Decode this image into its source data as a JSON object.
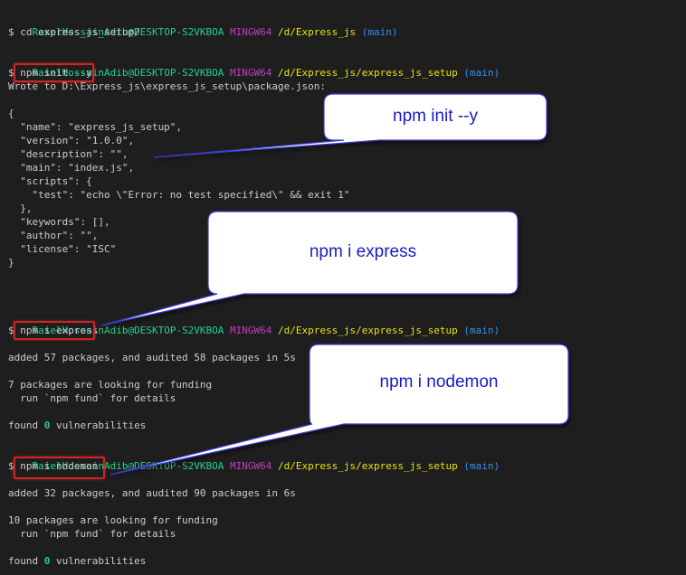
{
  "terminal": {
    "block1": {
      "prompt_user": "RaselHossainAdib@DESKTOP-S2VKBOA",
      "prompt_shell": "MINGW64",
      "prompt_path": "/d/Express_js",
      "prompt_branch": "(main)",
      "command_prefix": "$ ",
      "command": "cd express_js_setup/"
    },
    "block2": {
      "prompt_user": "RaselHossainAdib@DESKTOP-S2VKBOA",
      "prompt_shell": "MINGW64",
      "prompt_path": "/d/Express_js/express_js_setup",
      "prompt_branch": "(main)",
      "command_prefix": "$ ",
      "command": "npm init --y",
      "output": [
        "Wrote to D:\\Express_js\\express_js_setup\\package.json:",
        "",
        "{",
        "  \"name\": \"express_js_setup\",",
        "  \"version\": \"1.0.0\",",
        "  \"description\": \"\",",
        "  \"main\": \"index.js\",",
        "  \"scripts\": {",
        "    \"test\": \"echo \\\"Error: no test specified\\\" && exit 1\"",
        "  },",
        "  \"keywords\": [],",
        "  \"author\": \"\",",
        "  \"license\": \"ISC\"",
        "}"
      ]
    },
    "block3": {
      "prompt_user": "RaselHossainAdib@DESKTOP-S2VKBOA",
      "prompt_shell": "MINGW64",
      "prompt_path": "/d/Express_js/express_js_setup",
      "prompt_branch": "(main)",
      "command_prefix": "$ ",
      "command": "npm i express",
      "added_line": "added 57 packages, and audited 58 packages in 5s",
      "funding_line": "7 packages are looking for funding",
      "fund_hint": "  run `npm fund` for details",
      "found_prefix": "found ",
      "vuln_count": "0",
      "vuln_suffix": " vulnerabilities"
    },
    "block4": {
      "prompt_user": "RaselHossainAdib@DESKTOP-S2VKBOA",
      "prompt_shell": "MINGW64",
      "prompt_path": "/d/Express_js/express_js_setup",
      "prompt_branch": "(main)",
      "command_prefix": "$ ",
      "command": "npm i nodemon",
      "added_line": "added 32 packages, and audited 90 packages in 6s",
      "funding_line": "10 packages are looking for funding",
      "fund_hint": "  run `npm fund` for details",
      "found_prefix": "found ",
      "vuln_count": "0",
      "vuln_suffix": " vulnerabilities"
    }
  },
  "callouts": {
    "init": "npm init --y",
    "express": "npm i express",
    "nodemon": "npm i nodemon"
  },
  "colors": {
    "background": "#1e1e1e",
    "text": "#cccccc",
    "prompt_user": "#23d18b",
    "prompt_shell": "#bc3fbc",
    "prompt_path": "#e5e510",
    "prompt_branch": "#3b8eea",
    "highlight_border": "#d12424",
    "callout_fill": "#ffffff",
    "callout_border": "#3a3ad0",
    "callout_text": "#1a1ac8"
  }
}
